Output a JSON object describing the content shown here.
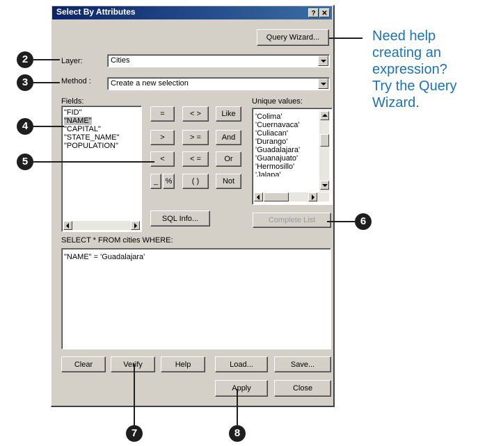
{
  "window": {
    "title": "Select By Attributes",
    "help_glyph": "?",
    "close_glyph": "✕"
  },
  "query_wizard_button": "Query Wizard...",
  "layer": {
    "label": "Layer:",
    "value": "Cities"
  },
  "method": {
    "label": "Method :",
    "value": "Create a new selection"
  },
  "fields": {
    "label": "Fields:",
    "items": [
      "\"FID\"",
      "\"NAME\"",
      "\"CAPITAL\"",
      "\"STATE_NAME\"",
      "\"POPULATION\""
    ],
    "selected": "\"NAME\""
  },
  "operators": [
    "=",
    "< >",
    "Like",
    ">",
    "> =",
    "And",
    "<",
    "< =",
    "Or",
    "_",
    "%",
    "( )",
    "Not"
  ],
  "unique_values": {
    "label": "Unique values:",
    "items": [
      "'Colima'",
      "'Cuernavaca'",
      "'Culiacan'",
      "'Durango'",
      "'Guadalajara'",
      "'Guanajuato'",
      "'Hermosillo'",
      "'Jalapa'"
    ]
  },
  "sql_info_button": "SQL Info...",
  "complete_list_button": "Complete List",
  "where_label": "SELECT * FROM cities WHERE:",
  "expression": "\"NAME\" = 'Guadalajara'",
  "bottom_buttons": {
    "clear": "Clear",
    "verify": "Verify",
    "help": "Help",
    "load": "Load...",
    "save": "Save...",
    "apply": "Apply",
    "close": "Close"
  },
  "callouts": [
    "2",
    "3",
    "4",
    "5",
    "6",
    "7",
    "8"
  ],
  "note_text": [
    "Need help",
    "creating an",
    "expression?",
    "Try the Query",
    "Wizard."
  ],
  "colors": {
    "title_bar": "#0a246a",
    "note": "#1a73b8",
    "dialog_face": "#d4d0c8"
  }
}
